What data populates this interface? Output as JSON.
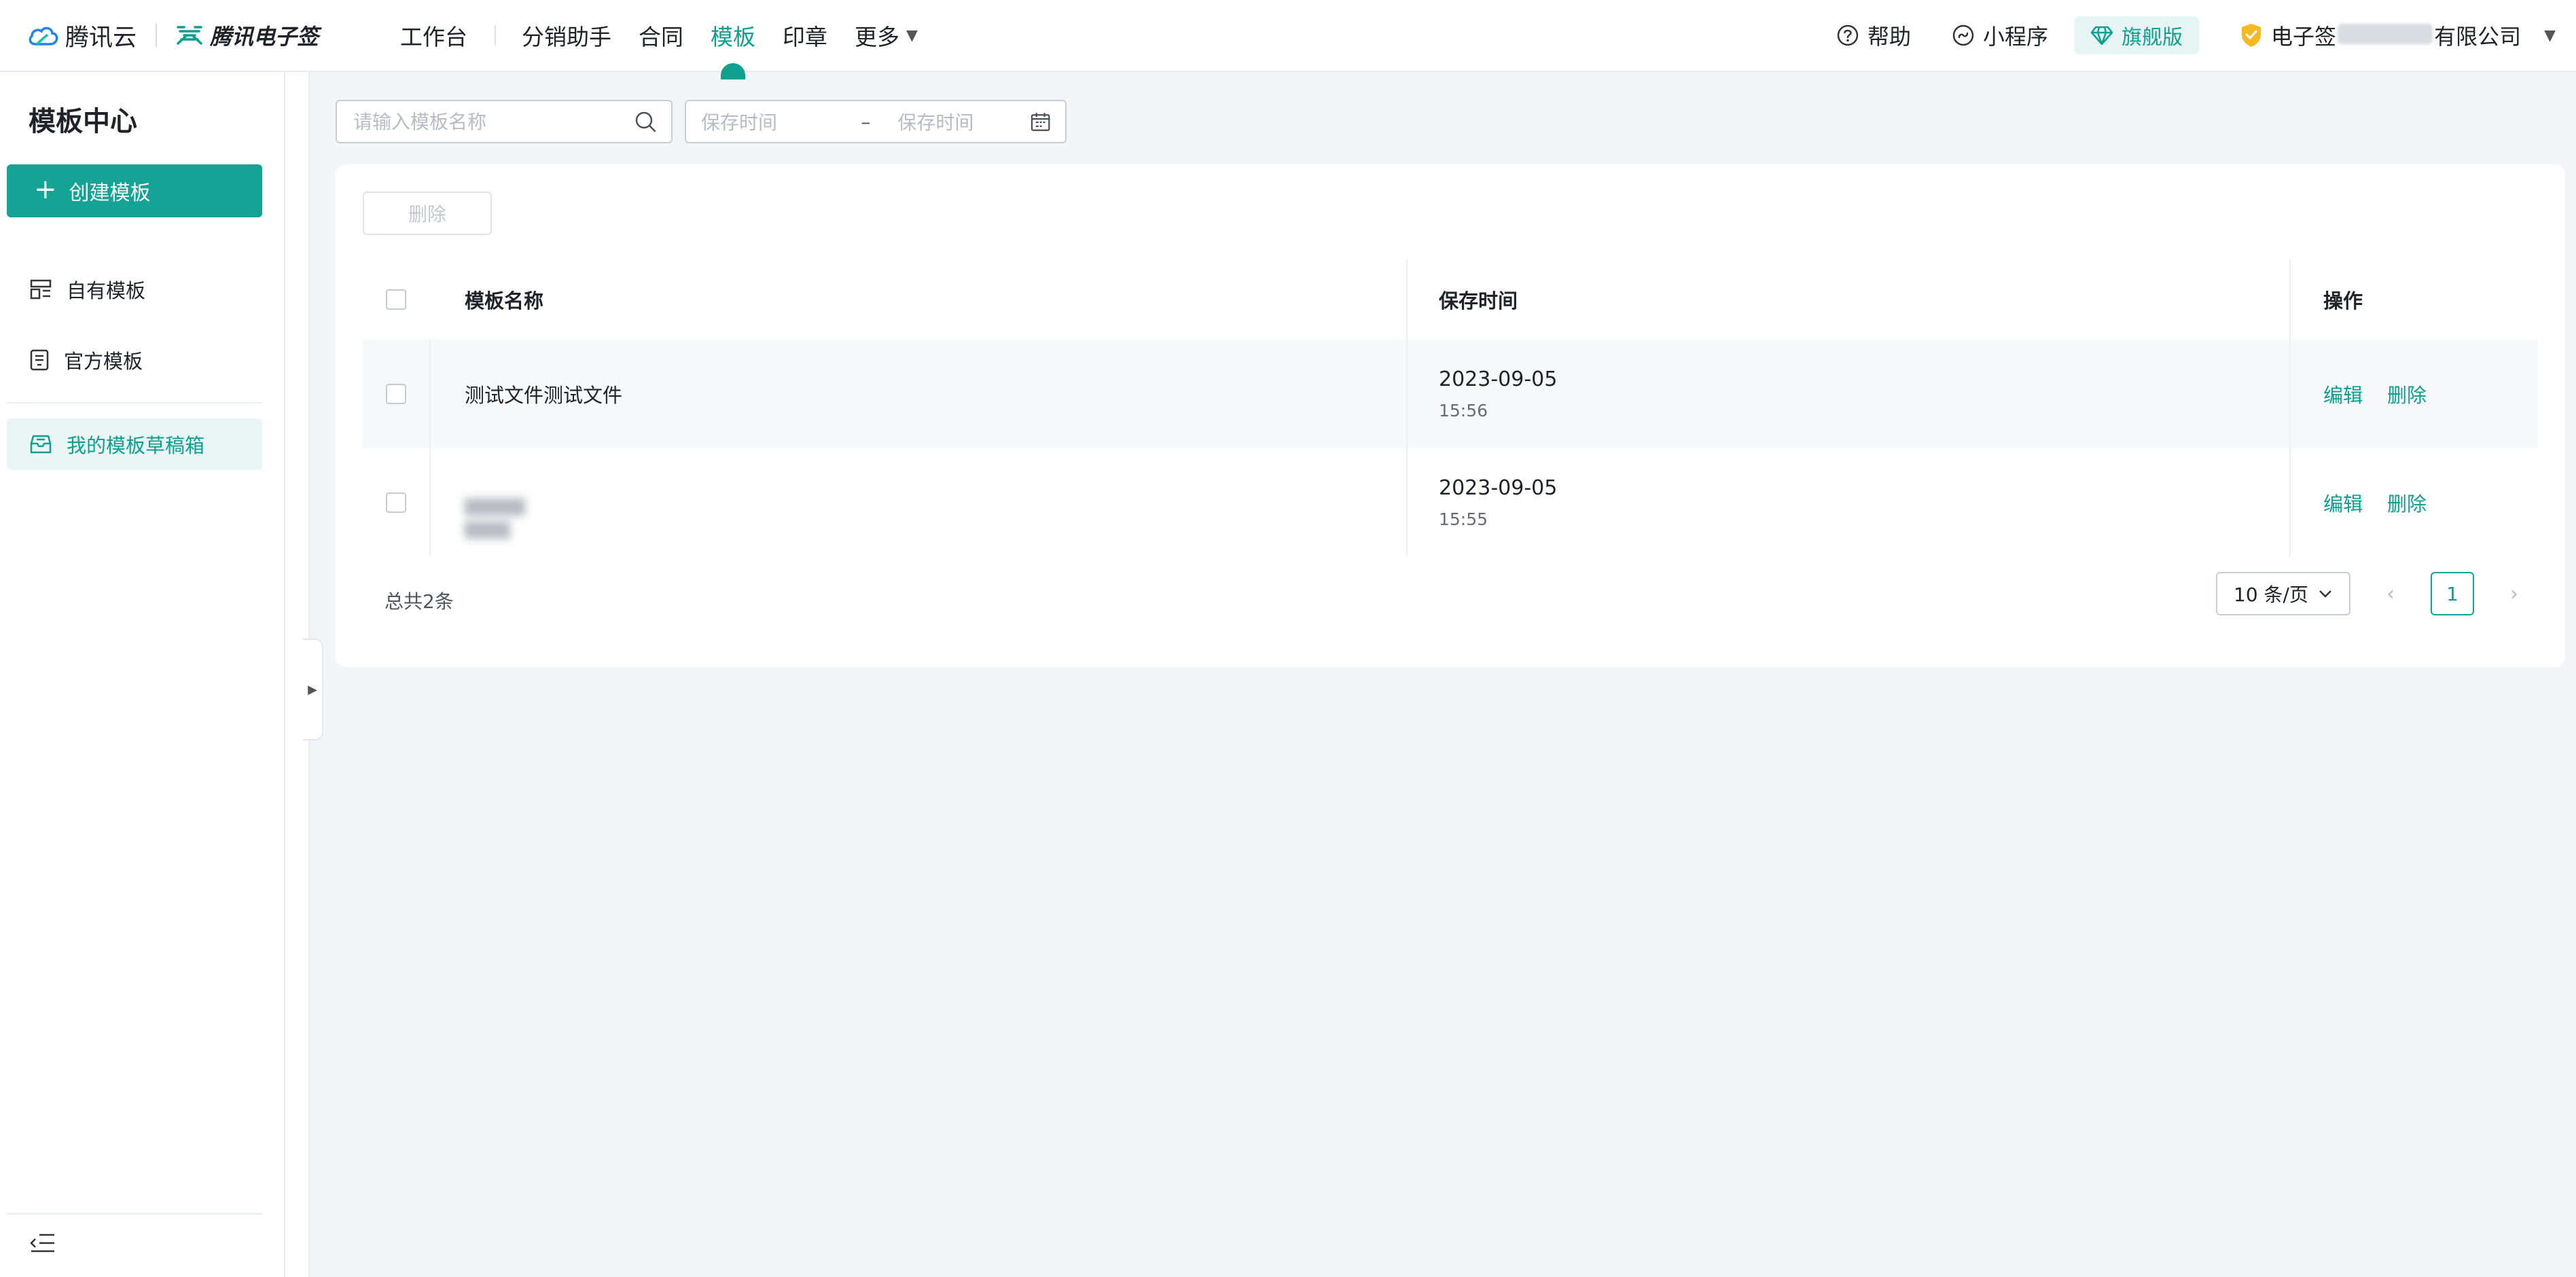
{
  "brand": {
    "cloud_name": "腾讯云",
    "esign_name": "腾讯电子签"
  },
  "nav": {
    "items": [
      {
        "label": "工作台"
      },
      {
        "label": "分销助手"
      },
      {
        "label": "合同"
      },
      {
        "label": "模板",
        "active": true
      },
      {
        "label": "印章"
      },
      {
        "label": "更多"
      }
    ]
  },
  "top_right": {
    "help": "帮助",
    "mini_program": "小程序",
    "edition": "旗舰版",
    "company_prefix": "电子签",
    "company_suffix": "有限公司"
  },
  "sidebar": {
    "title": "模板中心",
    "create_button": "创建模板",
    "items": [
      {
        "label": "自有模板",
        "icon": "layout-icon"
      },
      {
        "label": "官方模板",
        "icon": "document-icon"
      },
      {
        "label": "我的模板草稿箱",
        "icon": "draft-box-icon",
        "active": true
      }
    ]
  },
  "filters": {
    "search_placeholder": "请输入模板名称",
    "date_start_placeholder": "保存时间",
    "date_separator": "–",
    "date_end_placeholder": "保存时间"
  },
  "toolbar": {
    "delete_label": "删除"
  },
  "table": {
    "columns": {
      "name": "模板名称",
      "time": "保存时间",
      "ops": "操作"
    },
    "rows": [
      {
        "name": "测试文件测试文件",
        "date": "2023-09-05",
        "time": "15:56",
        "edit": "编辑",
        "delete": "删除"
      },
      {
        "name": "",
        "date": "2023-09-05",
        "time": "15:55",
        "edit": "编辑",
        "delete": "删除"
      }
    ]
  },
  "footer": {
    "total": "总共2条",
    "page_size": "10 条/页",
    "current_page": "1"
  },
  "colors": {
    "accent": "#14a394",
    "accent_text": "#0e9f8f",
    "background": "#f3f6f9"
  }
}
